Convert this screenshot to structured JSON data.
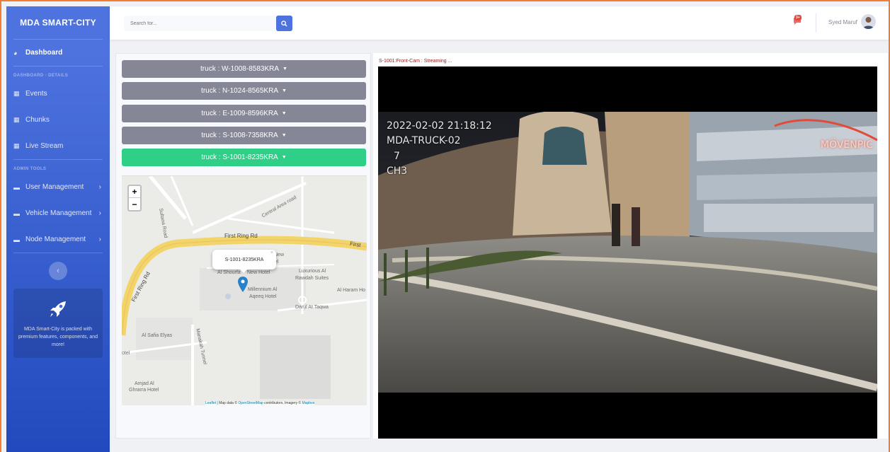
{
  "brand": {
    "name": "MDA SMART-CITY"
  },
  "sidebar": {
    "dashboard": "Dashboard",
    "heading_details": "DASHBOARD - DETAILS",
    "items_details": [
      {
        "label": "Events",
        "icon": "table-icon"
      },
      {
        "label": "Chunks",
        "icon": "table-icon"
      },
      {
        "label": "Live Stream",
        "icon": "table-icon"
      }
    ],
    "heading_admin": "ADMIN TOOLS",
    "items_admin": [
      {
        "label": "User Management",
        "icon": "folder-icon"
      },
      {
        "label": "Vehicle Management",
        "icon": "folder-icon"
      },
      {
        "label": "Node Management",
        "icon": "folder-icon"
      }
    ],
    "toggle_icon": "chevron-left-icon",
    "promo_text": "MDA Smart-City is packed with premium features, components, and more!",
    "promo_icon": "rocket-icon"
  },
  "topbar": {
    "search_placeholder": "Search for...",
    "alert_count": "3+",
    "username": "Syed Maruf"
  },
  "trucks": [
    {
      "label": "truck : W-1008-8583KRA",
      "active": false
    },
    {
      "label": "truck : N-1024-8565KRA",
      "active": false
    },
    {
      "label": "truck : E-1009-8596KRA",
      "active": false
    },
    {
      "label": "truck : S-1008-7358KRA",
      "active": false
    },
    {
      "label": "truck : S-1001-8235KRA",
      "active": true
    }
  ],
  "map": {
    "zoom_in": "+",
    "zoom_out": "−",
    "popup": "S-1001-8235KRA",
    "popup_close": "×",
    "labels": {
      "sultana_road": "Sultana Road",
      "central_area_road": "Central Area road",
      "first_ring_rd": "First Ring Rd",
      "first_ring_rd_2": "First",
      "first_ring_rd_3": "First Ring Rd",
      "al_shourfa": "Al Shourfa",
      "new": "New",
      "hotel": "Hotel",
      "new_hotel": "New Hotel",
      "luxurious": "Luxurious Al",
      "rawdah": "Rawdah Suites",
      "millennium": "Millennium Al",
      "aqeeq": "Aqeeq Hotel",
      "al_haram": "Al Haram Ho",
      "darul": "Darul At Taqwa",
      "al_safia": "Al Safia Elyas",
      "manakah": "Manakah Tunnel",
      "otel": "otel",
      "amjad": "Amjad Al",
      "ghrarra": "Ghrarra Hotel"
    },
    "attribution_leaflet": "Leaflet",
    "attribution_sep": " | Map data © ",
    "attribution_osm": "OpenStreetMap",
    "attribution_mid": " contributors, Imagery © ",
    "attribution_mapbox": "Mapbox"
  },
  "stream": {
    "title": "S-1001:Front-Cam : Streaming ...",
    "osd_datetime": "2022-02-02 21:18:12",
    "osd_truck": "MDA-TRUCK-02",
    "osd_7": "7",
    "osd_channel": "CH3",
    "sign_text": "MÖVENPIC"
  }
}
